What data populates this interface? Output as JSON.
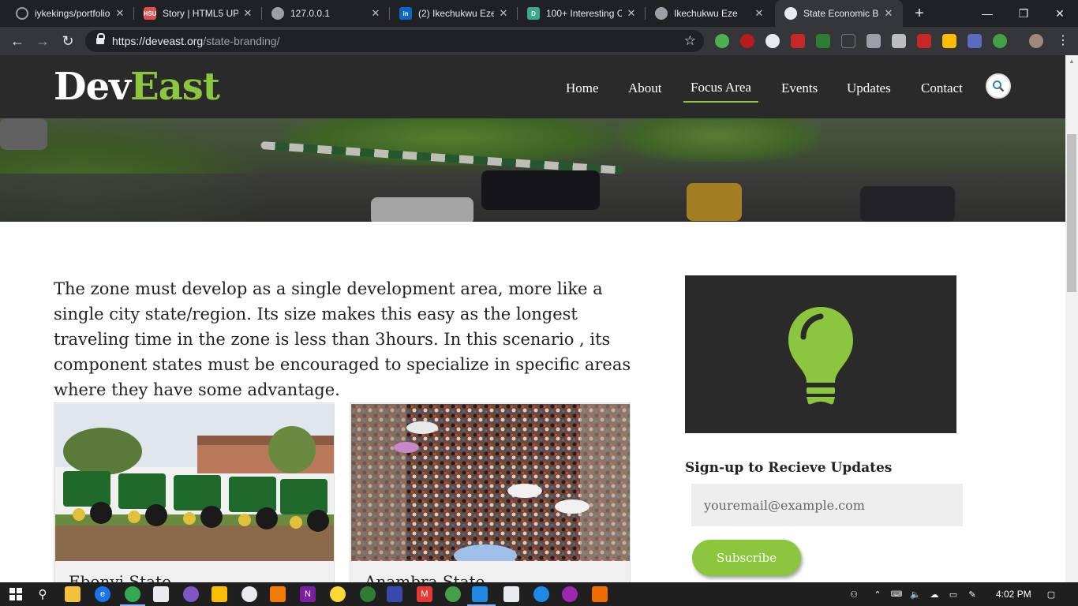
{
  "browser": {
    "tabs": [
      {
        "title": "iykekings/portfolio",
        "icon": "github-icon",
        "color": "#ffffff"
      },
      {
        "title": "Story | HTML5 UP",
        "icon": "html5up-icon",
        "color": "#e24d4d"
      },
      {
        "title": "127.0.0.1",
        "icon": "globe-icon",
        "color": "#9aa0a6"
      },
      {
        "title": "(2) Ikechukwu Eze",
        "icon": "linkedin-icon",
        "color": "#0a66c2"
      },
      {
        "title": "100+ Interesting C",
        "icon": "d-icon",
        "color": "#3aa88a"
      },
      {
        "title": "Ikechukwu Eze",
        "icon": "globe-icon",
        "color": "#9aa0a6"
      },
      {
        "title": "State Economic Br",
        "icon": "globe-icon",
        "color": "#9aa0a6"
      }
    ],
    "url_host": "https://deveast.org",
    "url_path": "/state-branding/"
  },
  "site": {
    "logo_dev": "Dev",
    "logo_east": "East",
    "nav": [
      "Home",
      "About",
      "Focus Area",
      "Events",
      "Updates",
      "Contact"
    ],
    "active_nav": "Focus Area",
    "accent": "#8cc63f"
  },
  "content": {
    "intro": "The zone must develop as a single development area, more like a single city state/region. Its size makes this easy as the longest traveling time in the zone is less than 3hours. In this scenario , its component states must be encouraged to specialize in specific areas where they have some advantage.",
    "cards": [
      {
        "caption": "Ebonyi State"
      },
      {
        "caption": "Anambra State"
      }
    ]
  },
  "sidebar": {
    "signup_title": "Sign-up to Recieve Updates",
    "email_placeholder": "youremail@example.com",
    "subscribe_label": "Subscribe"
  },
  "taskbar": {
    "time": "4:02 PM"
  }
}
